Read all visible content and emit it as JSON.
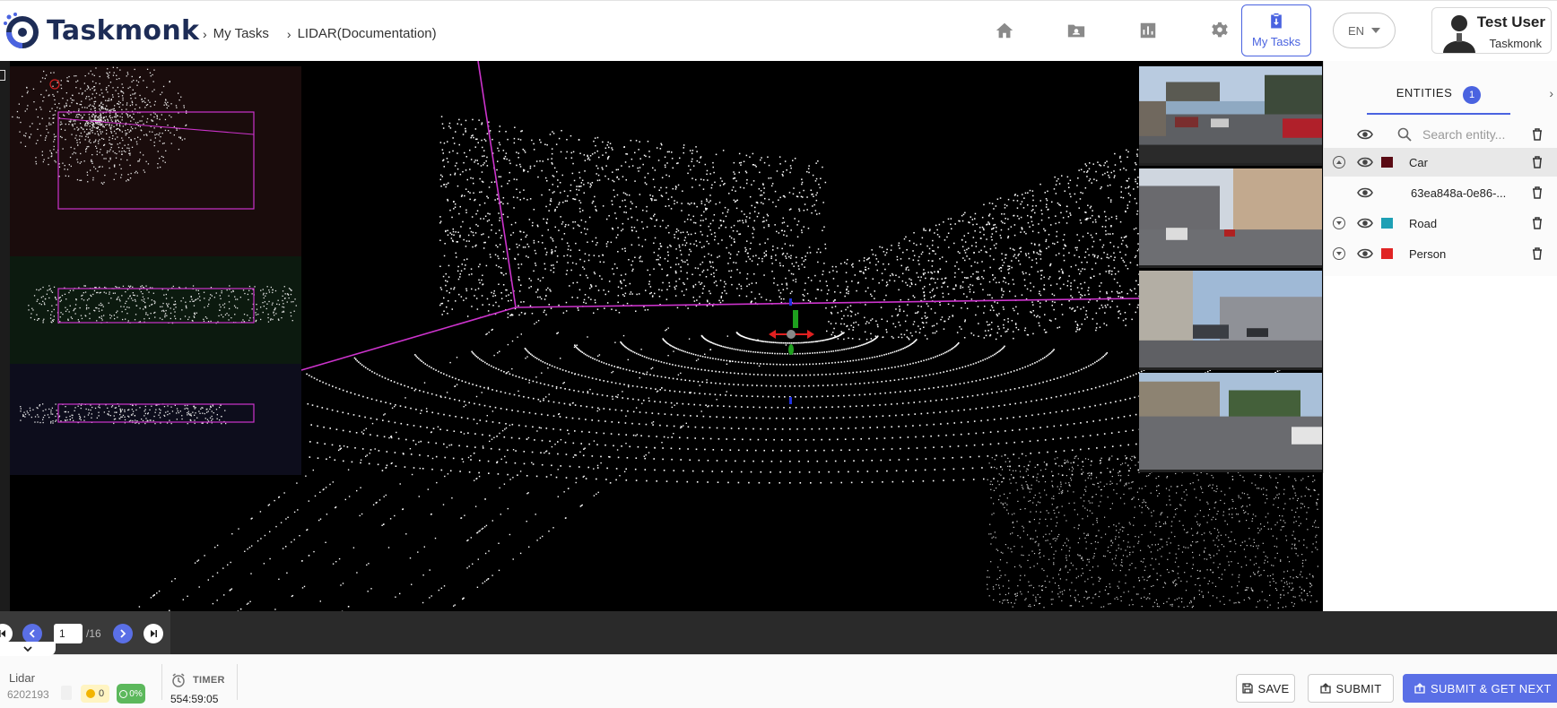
{
  "app": {
    "name": "Taskmonk"
  },
  "breadcrumb": {
    "items": [
      "My Tasks",
      "LIDAR(Documentation)"
    ]
  },
  "header": {
    "nav": [
      "home-icon",
      "folder-user-icon",
      "chart-icon",
      "gear-icon"
    ],
    "my_tasks_label": "My Tasks",
    "language": "EN",
    "user": {
      "name": "Test User",
      "org": "Taskmonk"
    }
  },
  "entities": {
    "title": "ENTITIES",
    "count": "1",
    "search_placeholder": "Search entity...",
    "items": [
      {
        "label": "Car",
        "color": "#5a0b14",
        "expanded": true,
        "selected": true
      },
      {
        "label": "63ea848a-0e86-...",
        "child": true
      },
      {
        "label": "Road",
        "color": "#1ea0b5",
        "expanded": false
      },
      {
        "label": "Person",
        "color": "#e02424",
        "expanded": false
      }
    ]
  },
  "pager": {
    "current": "1",
    "total": "/16"
  },
  "footer": {
    "task_type": "Lidar",
    "task_id": "6202193",
    "warnings": "0",
    "progress": "0%",
    "timer_label": "TIMER",
    "timer_value": "554:59:05",
    "save_label": "SAVE",
    "submit_label": "SUBMIT",
    "submit_next_label": "SUBMIT & GET NEXT"
  },
  "colors": {
    "accent": "#4a63e0",
    "annotation_box": "#cc33cc"
  }
}
